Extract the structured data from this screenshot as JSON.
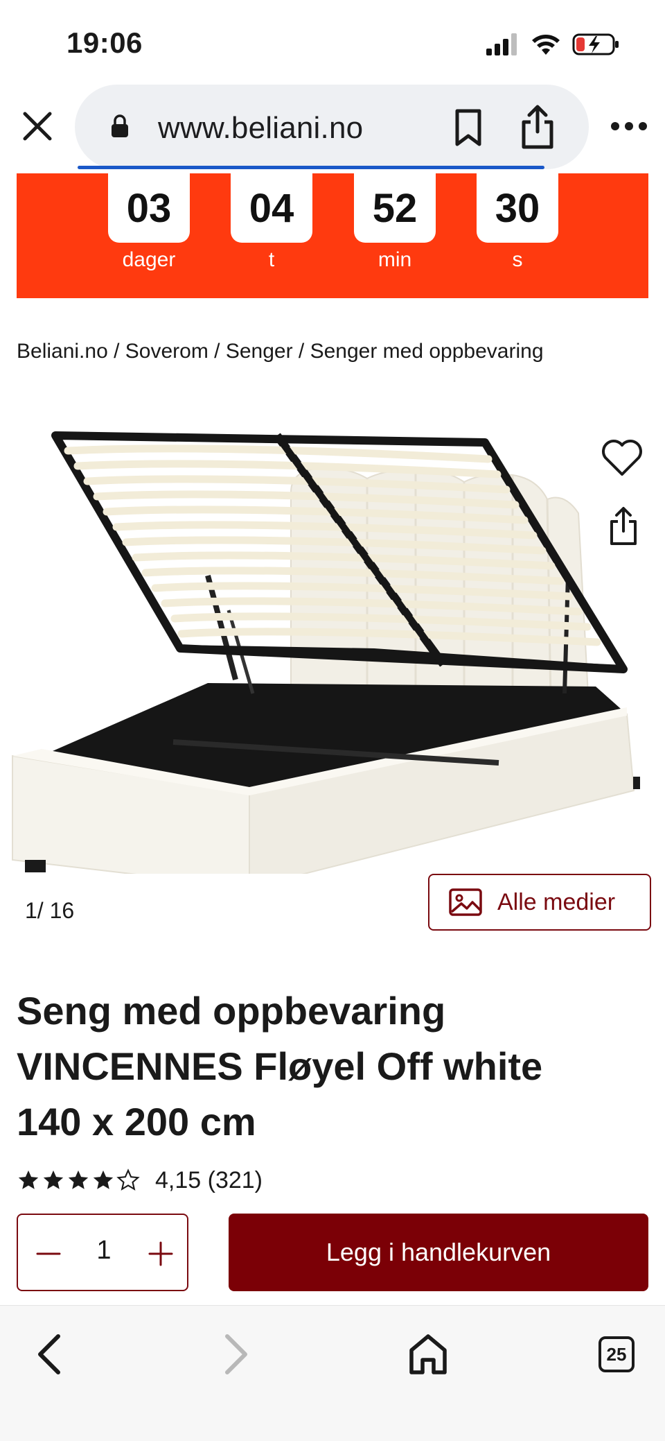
{
  "status_bar": {
    "time": "19:06",
    "icons": [
      "cellular-signal-icon",
      "wifi-icon",
      "battery-charging-icon"
    ]
  },
  "browser": {
    "url": "www.beliani.no",
    "icons": [
      "close-icon",
      "lock-icon",
      "bookmark-icon",
      "share-icon",
      "more-icon"
    ]
  },
  "countdown": {
    "units": [
      {
        "value": "03",
        "label": "dager"
      },
      {
        "value": "04",
        "label": "t"
      },
      {
        "value": "52",
        "label": "min"
      },
      {
        "value": "30",
        "label": "s"
      }
    ],
    "color": "#ff3a0f"
  },
  "breadcrumb": {
    "items": [
      "Beliani.no",
      "Soverom",
      "Senger",
      "Senger med oppbevaring"
    ],
    "separator": " / "
  },
  "gallery": {
    "counter_current": "1/",
    "counter_total": "16",
    "all_media_label": "Alle medier",
    "icons": [
      "heart-icon",
      "share-icon",
      "image-icon"
    ]
  },
  "product": {
    "title_line1": "Seng med oppbevaring",
    "title_line2": "VINCENNES Fløyel Off white",
    "title_line3": "140 x 200 cm",
    "rating_value": 4.15,
    "rating_text": "4,15 (321)",
    "stars_filled": 4,
    "stars_total": 5
  },
  "buy": {
    "quantity": "1",
    "add_to_cart_label": "Legg i handlekurven",
    "accent_color": "#7b0006"
  },
  "bottom_toolbar": {
    "tab_count": "25",
    "icons": [
      "back-icon",
      "forward-icon",
      "home-icon",
      "tabs-icon"
    ]
  }
}
